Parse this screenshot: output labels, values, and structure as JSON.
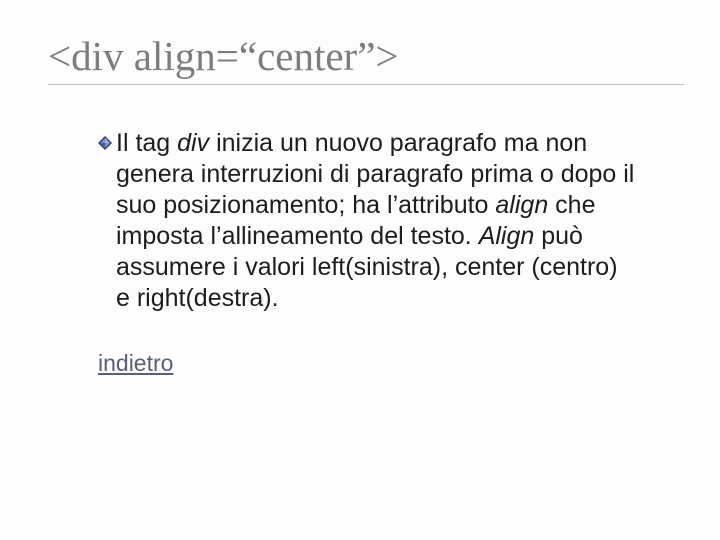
{
  "title": "<div align=“center”>",
  "body": {
    "pre": "Il tag ",
    "em1": "div",
    "mid1": " inizia un nuovo paragrafo ma non genera interruzioni di paragrafo prima o dopo il suo posizionamento; ha l’attributo ",
    "em2": "align",
    "mid2": " che imposta l’allineamento del testo. ",
    "em3": "Align",
    "post": " può assumere i valori left(sinistra), center (centro) e right(destra)."
  },
  "link": "indietro",
  "colors": {
    "title": "#7c7d7d",
    "text": "#1d1d1d",
    "link": "#5a5f77",
    "bullet_fill": "#7a8ec8",
    "bullet_dark": "#30406f"
  }
}
